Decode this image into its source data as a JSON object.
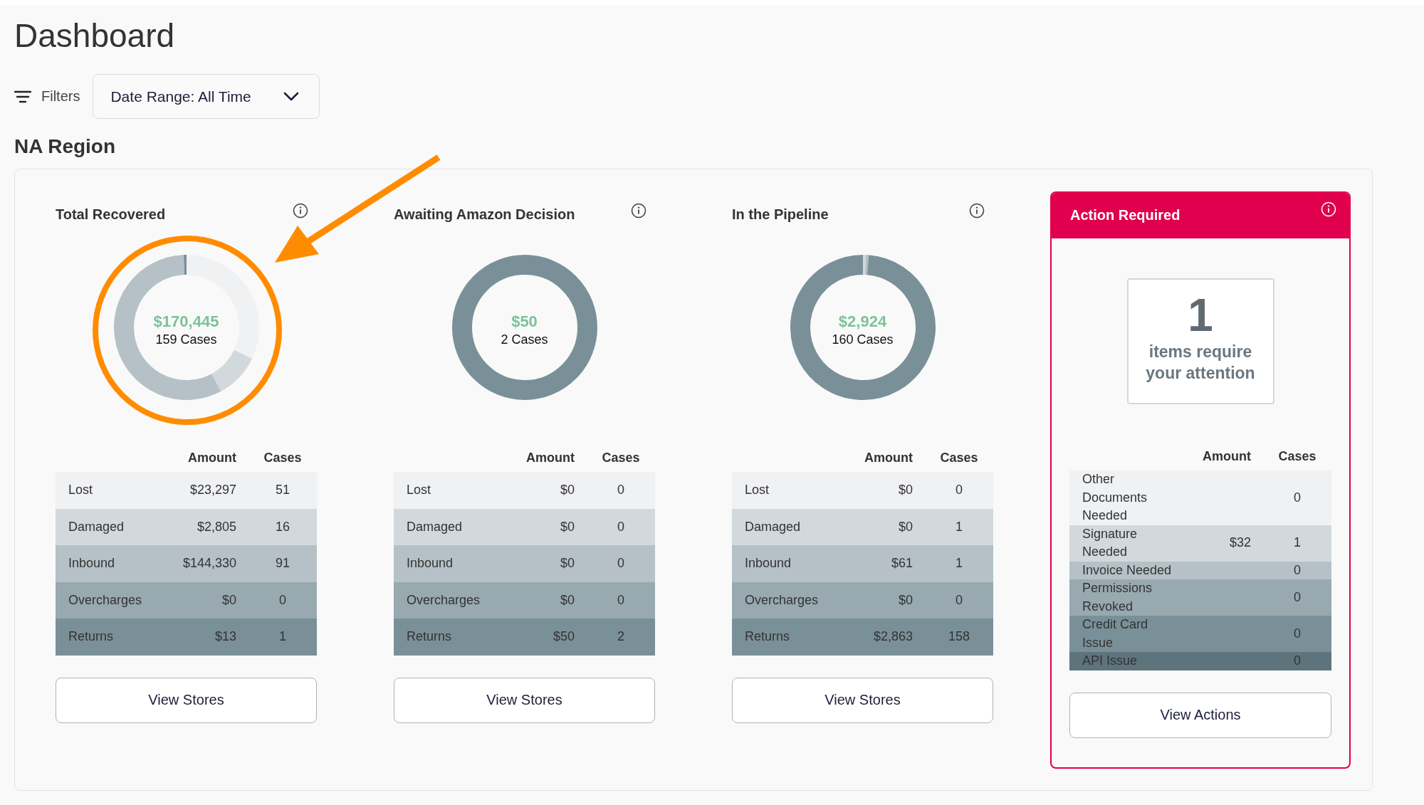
{
  "page": {
    "title": "Dashboard"
  },
  "filters": {
    "label": "Filters",
    "date_range": "Date Range: All Time"
  },
  "region": {
    "title": "NA Region",
    "cards": [
      {
        "title": "Total Recovered",
        "amount": "$170,445",
        "cases": "159 Cases",
        "columns": [
          "Amount",
          "Cases"
        ],
        "button": "View Stores",
        "rows": [
          {
            "label": "Lost",
            "amount": "$23,297",
            "cases": "51",
            "color": "#f0f1f3"
          },
          {
            "label": "Damaged",
            "amount": "$2,805",
            "cases": "16",
            "color": "#d1d9dd"
          },
          {
            "label": "Inbound",
            "amount": "$144,330",
            "cases": "91",
            "color": "#b5c1c7"
          },
          {
            "label": "Overcharges",
            "amount": "$0",
            "cases": "0",
            "color": "#98a9b0"
          },
          {
            "label": "Returns",
            "amount": "$13",
            "cases": "1",
            "color": "#7a9099"
          }
        ]
      },
      {
        "title": "Awaiting Amazon Decision",
        "amount": "$50",
        "cases": "2 Cases",
        "columns": [
          "Amount",
          "Cases"
        ],
        "button": "View Stores",
        "rows": [
          {
            "label": "Lost",
            "amount": "$0",
            "cases": "0",
            "color": "#f0f1f3"
          },
          {
            "label": "Damaged",
            "amount": "$0",
            "cases": "0",
            "color": "#d1d9dd"
          },
          {
            "label": "Inbound",
            "amount": "$0",
            "cases": "0",
            "color": "#b5c1c7"
          },
          {
            "label": "Overcharges",
            "amount": "$0",
            "cases": "0",
            "color": "#98a9b0"
          },
          {
            "label": "Returns",
            "amount": "$50",
            "cases": "2",
            "color": "#7a9099"
          }
        ]
      },
      {
        "title": "In the Pipeline",
        "amount": "$2,924",
        "cases": "160 Cases",
        "columns": [
          "Amount",
          "Cases"
        ],
        "button": "View Stores",
        "rows": [
          {
            "label": "Lost",
            "amount": "$0",
            "cases": "0",
            "color": "#f0f1f3"
          },
          {
            "label": "Damaged",
            "amount": "$0",
            "cases": "1",
            "color": "#d1d9dd"
          },
          {
            "label": "Inbound",
            "amount": "$61",
            "cases": "1",
            "color": "#b5c1c7"
          },
          {
            "label": "Overcharges",
            "amount": "$0",
            "cases": "0",
            "color": "#98a9b0"
          },
          {
            "label": "Returns",
            "amount": "$2,863",
            "cases": "158",
            "color": "#7a9099"
          }
        ]
      }
    ],
    "action_card": {
      "title": "Action Required",
      "count": "1",
      "message": "items require your attention",
      "columns": [
        "Amount",
        "Cases"
      ],
      "button": "View Actions",
      "rows": [
        {
          "label": "Other Documents Needed",
          "cases": "0",
          "color": "#f0f1f3"
        },
        {
          "label": "Signature Needed",
          "amount": "$32",
          "cases": "1",
          "color": "#d1d9dd"
        },
        {
          "label": "Invoice Needed",
          "cases": "0",
          "color": "#b5c1c7"
        },
        {
          "label": "Permissions Revoked",
          "cases": "0",
          "color": "#98a9b0"
        },
        {
          "label": "Credit Card Issue",
          "cases": "0",
          "color": "#7a9099"
        },
        {
          "label": "API Issue",
          "cases": "0",
          "color": "#5e747c"
        }
      ]
    }
  }
}
